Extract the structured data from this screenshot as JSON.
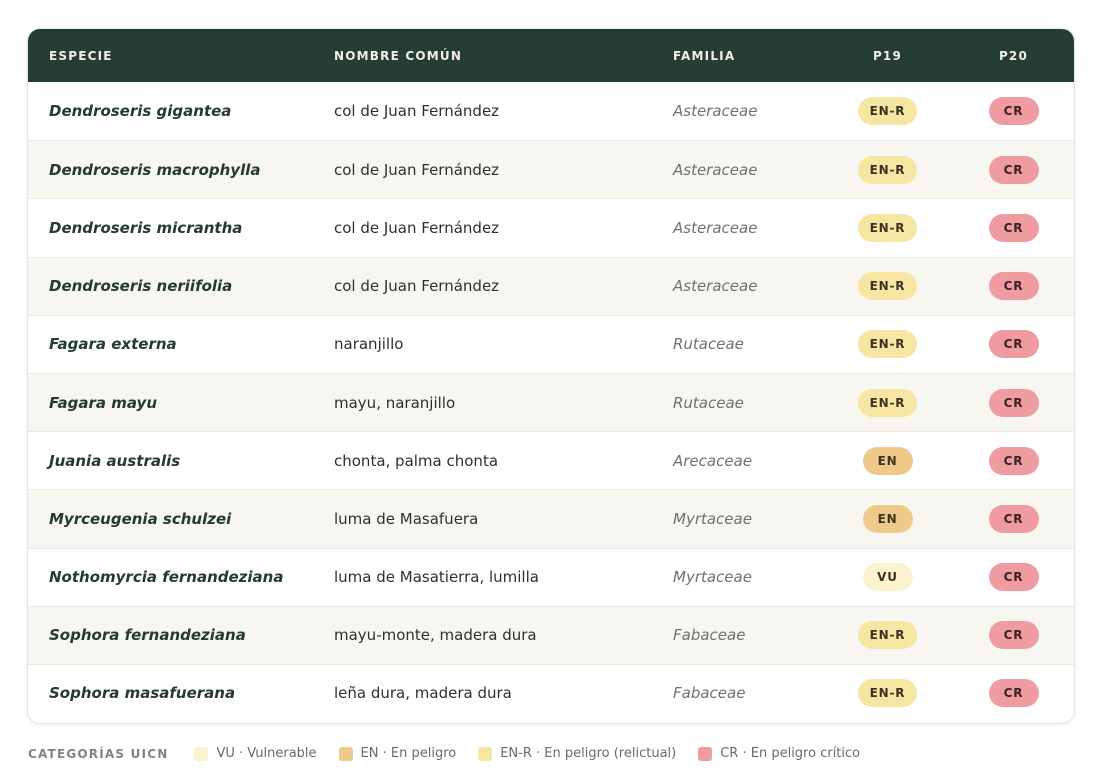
{
  "header": {
    "esp": "ESPECIE",
    "nom": "NOMBRE COMÚN",
    "fam": "FAMILIA",
    "p19": "P19",
    "p20": "P20"
  },
  "rows": [
    {
      "esp": "Dendroseris gigantea",
      "nom": "col de Juan Fernández",
      "fam": "Asteraceae",
      "p19": "EN-R",
      "p20": "CR"
    },
    {
      "esp": "Dendroseris macrophylla",
      "nom": "col de Juan Fernández",
      "fam": "Asteraceae",
      "p19": "EN-R",
      "p20": "CR"
    },
    {
      "esp": "Dendroseris micrantha",
      "nom": "col de Juan Fernández",
      "fam": "Asteraceae",
      "p19": "EN-R",
      "p20": "CR"
    },
    {
      "esp": "Dendroseris neriifolia",
      "nom": "col de Juan Fernández",
      "fam": "Asteraceae",
      "p19": "EN-R",
      "p20": "CR"
    },
    {
      "esp": "Fagara externa",
      "nom": "naranjillo",
      "fam": "Rutaceae",
      "p19": "EN-R",
      "p20": "CR"
    },
    {
      "esp": "Fagara mayu",
      "nom": "mayu, naranjillo",
      "fam": "Rutaceae",
      "p19": "EN-R",
      "p20": "CR"
    },
    {
      "esp": "Juania australis",
      "nom": "chonta, palma chonta",
      "fam": "Arecaceae",
      "p19": "EN",
      "p20": "CR"
    },
    {
      "esp": "Myrceugenia schulzei",
      "nom": "luma de Masafuera",
      "fam": "Myrtaceae",
      "p19": "EN",
      "p20": "CR"
    },
    {
      "esp": "Nothomyrcia fernandeziana",
      "nom": "luma de Masatierra, lumilla",
      "fam": "Myrtaceae",
      "p19": "VU",
      "p20": "CR"
    },
    {
      "esp": "Sophora fernandeziana",
      "nom": "mayu-monte, madera dura",
      "fam": "Fabaceae",
      "p19": "EN-R",
      "p20": "CR"
    },
    {
      "esp": "Sophora masafuerana",
      "nom": "leña dura, madera dura",
      "fam": "Fabaceae",
      "p19": "EN-R",
      "p20": "CR"
    }
  ],
  "legend": {
    "title": "CATEGORÍAS UICN",
    "items": [
      {
        "label": "VU · Vulnerable",
        "color": "#fbf3cf"
      },
      {
        "label": "EN · En peligro",
        "color": "#efc98a"
      },
      {
        "label": "EN-R · En peligro (relictual)",
        "color": "#f5e6a4"
      },
      {
        "label": "CR · En peligro crítico",
        "color": "#ee9ba1"
      }
    ]
  },
  "colors": {
    "header_bg": "#253d34",
    "vu": "#fbf3cf",
    "en": "#efc98a",
    "enr": "#f5e6a4",
    "cr": "#ee9ba1"
  }
}
